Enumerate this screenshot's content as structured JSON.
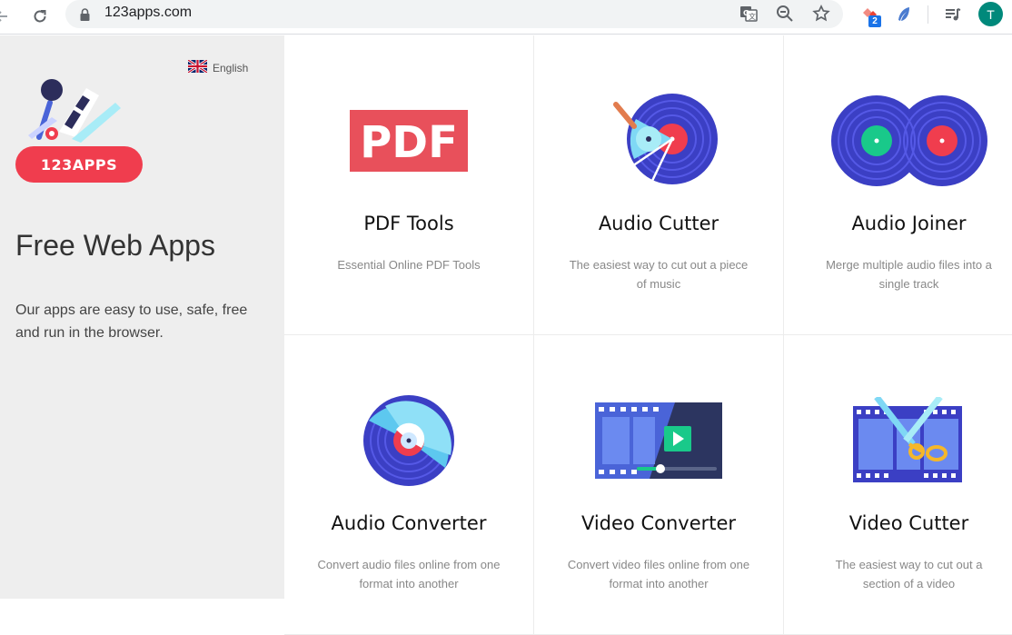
{
  "browser": {
    "url": "123apps.com",
    "profile_initial": "T",
    "extension_badge": "2"
  },
  "sidebar": {
    "language": "English",
    "logo_text": "123APPS",
    "title": "Free Web Apps",
    "description": "Our apps are easy to use, safe, free and run in the browser."
  },
  "apps": [
    {
      "name": "PDF Tools",
      "desc": "Essential Online PDF Tools",
      "icon": "pdf-icon",
      "icon_text": "PDF"
    },
    {
      "name": "Audio Cutter",
      "desc": "The easiest way to cut out a piece of music",
      "icon": "audio-cutter-icon"
    },
    {
      "name": "Audio Joiner",
      "desc": "Merge multiple audio files into a single track",
      "icon": "audio-joiner-icon"
    },
    {
      "name": "Audio Converter",
      "desc": "Convert audio files online from one format into another",
      "icon": "audio-converter-icon"
    },
    {
      "name": "Video Converter",
      "desc": "Convert video files online from one format into another",
      "icon": "video-converter-icon"
    },
    {
      "name": "Video Cutter",
      "desc": "The easiest way to cut out a section of a video",
      "icon": "video-cutter-icon"
    }
  ],
  "colors": {
    "brand_red": "#f03d4e",
    "pdf_red": "#e8505b",
    "vinyl_blue": "#3b3fc4",
    "accent_green": "#19c98a",
    "avatar_teal": "#00897b"
  }
}
